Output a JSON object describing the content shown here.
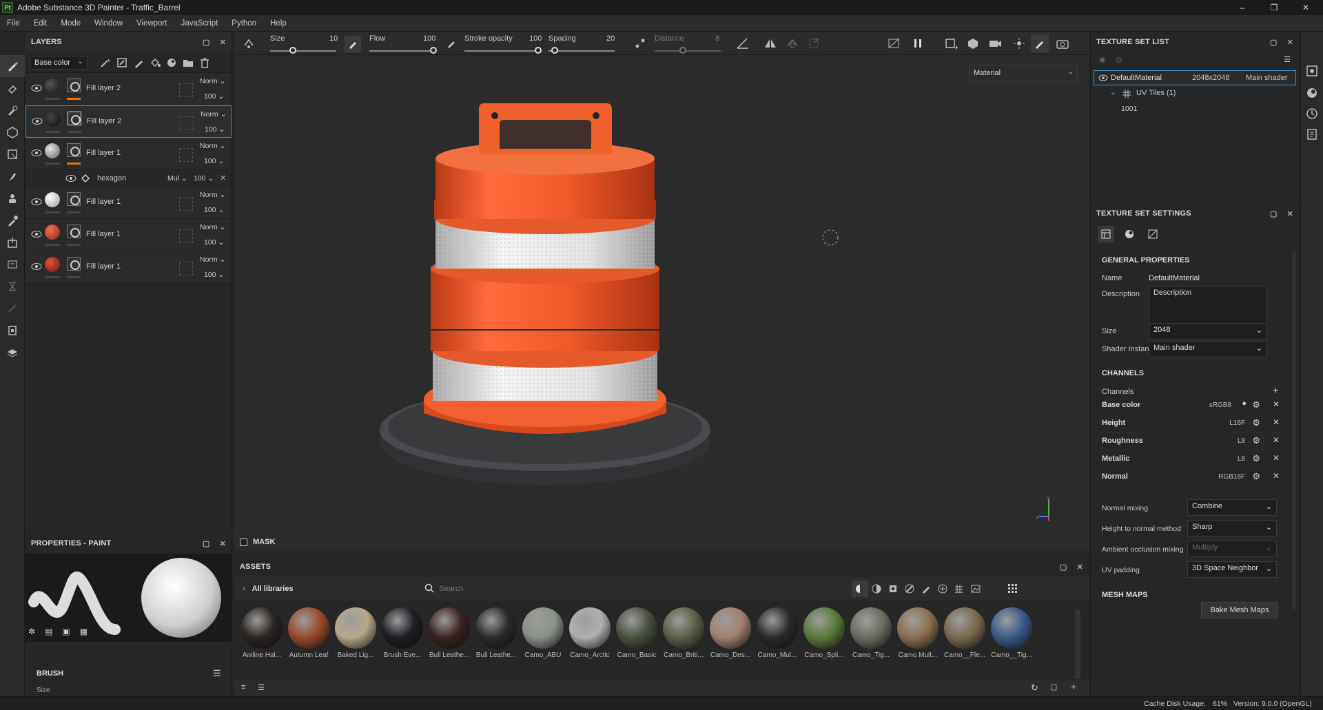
{
  "window": {
    "title": "Adobe Substance 3D Painter - Traffic_Barrel",
    "logo_text": "Pt"
  },
  "menu": [
    "File",
    "Edit",
    "Mode",
    "Window",
    "Viewport",
    "JavaScript",
    "Python",
    "Help"
  ],
  "toolbar": {
    "size_label": "Size",
    "size_value": "10",
    "flow_label": "Flow",
    "flow_value": "100",
    "stroke_opacity_label": "Stroke opacity",
    "stroke_opacity_value": "100",
    "spacing_label": "Spacing",
    "spacing_value": "20",
    "distance_label": "Distance",
    "distance_value": "8"
  },
  "layers": {
    "title": "LAYERS",
    "channel_select": "Base color",
    "rows": [
      {
        "name": "Fill layer 2",
        "blend": "Norm",
        "opacity": "100",
        "ball": "#1a1a1a",
        "accent": "#e0761e"
      },
      {
        "name": "Fill layer 2",
        "blend": "Norm",
        "opacity": "100",
        "ball": "#1a1a1a",
        "accent": ""
      },
      {
        "name": "Fill layer 1",
        "blend": "Norm",
        "opacity": "100",
        "ball": "#9a9a9a",
        "accent": "#e0761e"
      },
      {
        "name": "Fill layer 1",
        "blend": "Norm",
        "opacity": "100",
        "ball": "#d8d8d8",
        "accent": ""
      },
      {
        "name": "Fill layer 1",
        "blend": "Norm",
        "opacity": "100",
        "ball": "#c0432a",
        "accent": ""
      },
      {
        "name": "Fill layer 1",
        "blend": "Norm",
        "opacity": "100",
        "ball": "#a52c1c",
        "accent": ""
      }
    ],
    "effect": {
      "name": "hexagon",
      "blend": "Mul",
      "opacity": "100"
    }
  },
  "properties": {
    "title": "PROPERTIES - PAINT",
    "brush_label": "BRUSH",
    "size_label": "Size"
  },
  "viewport": {
    "mode_select": "Material"
  },
  "mask": {
    "label": "MASK"
  },
  "assets": {
    "title": "ASSETS",
    "library": "All libraries",
    "search_placeholder": "Search",
    "materials": [
      {
        "label": "Aniline Hal...",
        "color": "#2a2422"
      },
      {
        "label": "Autumn Leaf",
        "color": "#9a4a2a"
      },
      {
        "label": "Baked Lig...",
        "color": "#b8a88a"
      },
      {
        "label": "Brush Eve...",
        "color": "#1e1e22"
      },
      {
        "label": "Bull Leathe...",
        "color": "#3a2220"
      },
      {
        "label": "Bull Leathe...",
        "color": "#2a2a2a"
      },
      {
        "label": "Camo_ABU",
        "color": "#8a9088"
      },
      {
        "label": "Camo_Arctic",
        "color": "#b0b0b0"
      },
      {
        "label": "Camo_Basic",
        "color": "#4a5040"
      },
      {
        "label": "Camo_Briti...",
        "color": "#5a6048"
      },
      {
        "label": "Camo_Des...",
        "color": "#a08070"
      },
      {
        "label": "Camo_Mul...",
        "color": "#2a2a2a"
      },
      {
        "label": "Camo_Spli...",
        "color": "#5a7a3a"
      },
      {
        "label": "Camo_Tig...",
        "color": "#6a6e60"
      },
      {
        "label": "Camo Mult...",
        "color": "#8a7050"
      },
      {
        "label": "Camo__Fle...",
        "color": "#7a6a50"
      },
      {
        "label": "Camo__Tig...",
        "color": "#3a5a8a"
      }
    ]
  },
  "texture_set_list": {
    "title": "TEXTURE SET LIST",
    "set_name": "DefaultMaterial",
    "set_res": "2048x2048",
    "set_shader": "Main shader",
    "uv_tiles": "UV Tiles (1)",
    "tile": "1001"
  },
  "texture_set_settings": {
    "title": "TEXTURE SET SETTINGS",
    "general_title": "GENERAL PROPERTIES",
    "name_label": "Name",
    "name_value": "DefaultMaterial",
    "desc_label": "Description",
    "desc_value": "Description",
    "size_label": "Size",
    "size_value": "2048",
    "shader_label": "Shader Instance",
    "shader_value": "Main shader",
    "channels_title": "CHANNELS",
    "channels_label": "Channels",
    "channels": [
      {
        "name": "Base color",
        "format": "sRGB8"
      },
      {
        "name": "Height",
        "format": "L16F"
      },
      {
        "name": "Roughness",
        "format": "L8"
      },
      {
        "name": "Metallic",
        "format": "L8"
      },
      {
        "name": "Normal",
        "format": "RGB16F"
      }
    ],
    "normal_mixing_label": "Normal mixing",
    "normal_mixing_value": "Combine",
    "h2n_label": "Height to normal method",
    "h2n_value": "Sharp",
    "ao_label": "Ambient occlusion mixing",
    "ao_value": "Multiply",
    "uv_padding_label": "UV padding",
    "uv_padding_value": "3D Space Neighbor",
    "mesh_maps_title": "MESH MAPS",
    "bake_button": "Bake Mesh Maps"
  },
  "status": {
    "cache_label": "Cache Disk Usage:",
    "cache_value": "61%",
    "version": "Version: 9.0.0 (OpenGL)"
  },
  "colors": {
    "accent": "#3d8fd8",
    "orange": "#e0761e",
    "barrel_orange": "#f0602a"
  }
}
